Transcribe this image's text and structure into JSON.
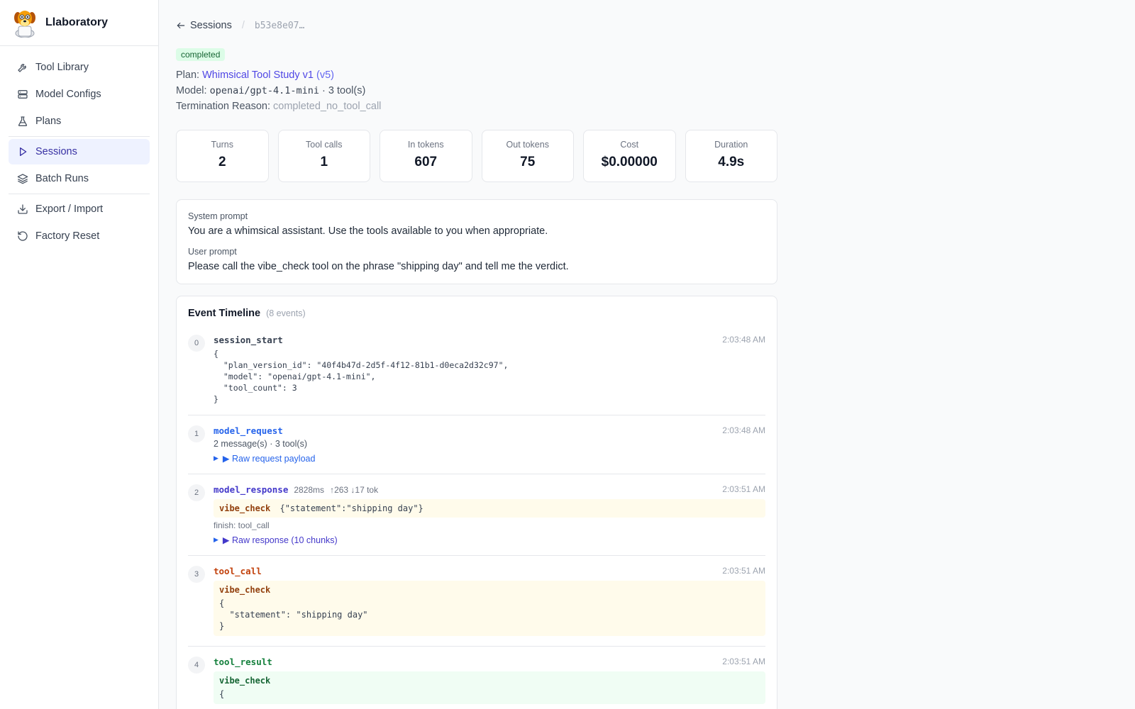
{
  "app": {
    "name": "Llaboratory"
  },
  "sidebar": {
    "items": [
      {
        "label": "Tool Library",
        "icon": "wrench-icon"
      },
      {
        "label": "Model Configs",
        "icon": "server-icon"
      },
      {
        "label": "Plans",
        "icon": "flask-icon"
      },
      {
        "label": "Sessions",
        "icon": "play-icon",
        "active": true
      },
      {
        "label": "Batch Runs",
        "icon": "layers-icon"
      },
      {
        "label": "Export / Import",
        "icon": "download-icon"
      },
      {
        "label": "Factory Reset",
        "icon": "reset-icon"
      }
    ]
  },
  "breadcrumb": {
    "back_label": "Sessions",
    "separator": "/",
    "session_id": "b53e8e07…"
  },
  "session": {
    "status": "completed",
    "plan_label": "Plan:",
    "plan_name": "Whimsical Tool Study v1",
    "plan_version": "(v5)",
    "model_label": "Model:",
    "model_name": "openai/gpt-4.1-mini",
    "model_tools": "· 3 tool(s)",
    "termination_label": "Termination Reason:",
    "termination_value": "completed_no_tool_call"
  },
  "stats": [
    {
      "label": "Turns",
      "value": "2"
    },
    {
      "label": "Tool calls",
      "value": "1"
    },
    {
      "label": "In tokens",
      "value": "607"
    },
    {
      "label": "Out tokens",
      "value": "75"
    },
    {
      "label": "Cost",
      "value": "$0.00000"
    },
    {
      "label": "Duration",
      "value": "4.9s"
    }
  ],
  "prompts": {
    "system_label": "System prompt",
    "system_text": "You are a whimsical assistant. Use the tools available to you when appropriate.",
    "user_label": "User prompt",
    "user_text": "Please call the vibe_check tool on the phrase \"shipping day\" and tell me the verdict."
  },
  "timeline": {
    "title": "Event Timeline",
    "count": "(8 events)",
    "events": [
      {
        "index": "0",
        "type": "session_start",
        "time": "2:03:48 AM",
        "json": "{\n  \"plan_version_id\": \"40f4b47d-2d5f-4f12-81b1-d0eca2d32c97\",\n  \"model\": \"openai/gpt-4.1-mini\",\n  \"tool_count\": 3\n}"
      },
      {
        "index": "1",
        "type": "model_request",
        "time": "2:03:48 AM",
        "summary": "2 message(s) · 3 tool(s)",
        "toggle": "▶ Raw request payload"
      },
      {
        "index": "2",
        "type": "model_response",
        "time": "2:03:51 AM",
        "latency": "2828ms",
        "tokens": "↑263 ↓17 tok",
        "call_name": "vibe_check",
        "call_args": "{\"statement\":\"shipping day\"}",
        "finish": "finish: tool_call",
        "toggle": "▶ Raw response (10 chunks)"
      },
      {
        "index": "3",
        "type": "tool_call",
        "time": "2:03:51 AM",
        "call_name": "vibe_check",
        "json": "{\n  \"statement\": \"shipping day\"\n}"
      },
      {
        "index": "4",
        "type": "tool_result",
        "time": "2:03:51 AM",
        "call_name": "vibe_check",
        "json": "{"
      }
    ]
  }
}
